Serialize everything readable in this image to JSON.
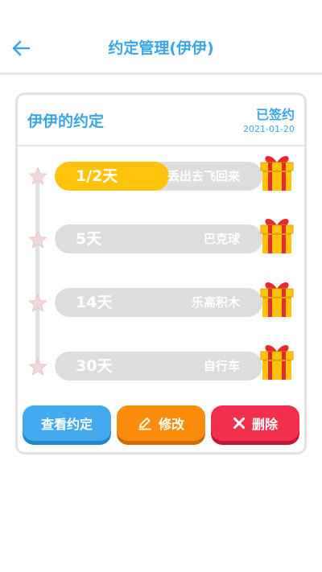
{
  "header": {
    "title": "约定管理(伊伊)",
    "back_icon": "arrow-left-icon"
  },
  "card": {
    "title": "伊伊的约定",
    "status": "已签约",
    "date": "2021-01-20"
  },
  "milestones": [
    {
      "days": "1/2天",
      "reward": "丢出去飞回来",
      "progress": 0.55
    },
    {
      "days": "5天",
      "reward": "巴克球",
      "progress": 0
    },
    {
      "days": "14天",
      "reward": "乐高积木",
      "progress": 0
    },
    {
      "days": "30天",
      "reward": "自行车",
      "progress": 0
    }
  ],
  "actions": {
    "view_label": "查看约定",
    "edit_label": "修改",
    "delete_label": "删除"
  },
  "colors": {
    "accent": "#3aa6e8",
    "progress": "#ffc30b",
    "track": "#dddddd",
    "view_button": "#44aaf0",
    "edit_button": "#fb8c0c",
    "delete_button": "#f2304e"
  }
}
